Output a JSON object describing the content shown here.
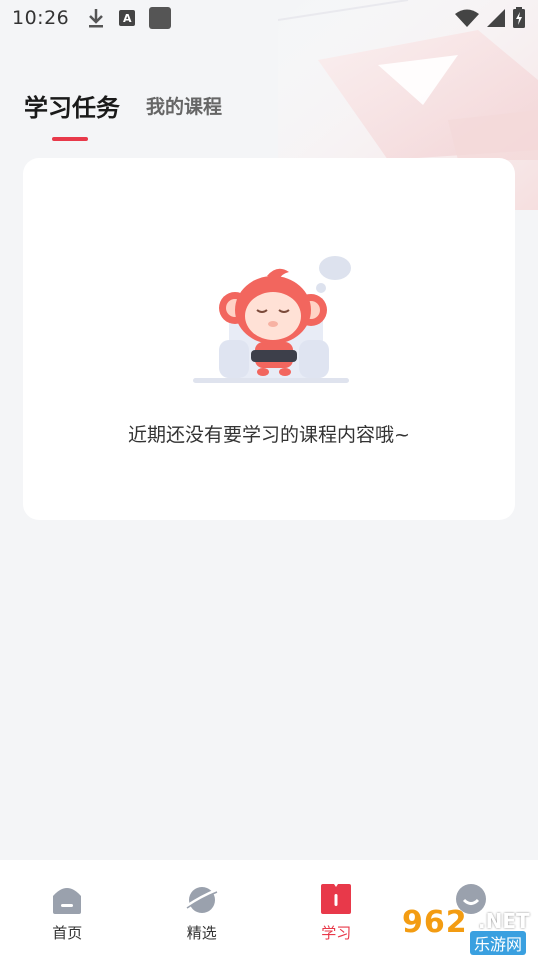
{
  "status_bar": {
    "time": "10:26",
    "left_icons": [
      "download-icon",
      "text-a-icon",
      "app-square-icon"
    ],
    "right_icons": [
      "wifi-icon",
      "signal-icon",
      "battery-icon"
    ]
  },
  "tabs": [
    {
      "label": "学习任务",
      "active": true
    },
    {
      "label": "我的课程",
      "active": false
    }
  ],
  "empty_state": {
    "illustration": "monkey-sleeping-illustration",
    "message": "近期还没有要学习的课程内容哦~"
  },
  "bottom_nav": [
    {
      "label": "首页",
      "icon": "home-icon",
      "active": false
    },
    {
      "label": "精选",
      "icon": "planet-icon",
      "active": false
    },
    {
      "label": "学习",
      "icon": "book-icon",
      "active": true
    },
    {
      "label": "",
      "icon": "profile-icon",
      "active": false
    }
  ],
  "watermark": {
    "number": "962",
    "suffix": ".NET",
    "chinese": "乐游网"
  },
  "colors": {
    "accent": "#e8394a",
    "background": "#f4f5f7",
    "card": "#ffffff",
    "nav_inactive_icon": "#9aa1ad"
  }
}
